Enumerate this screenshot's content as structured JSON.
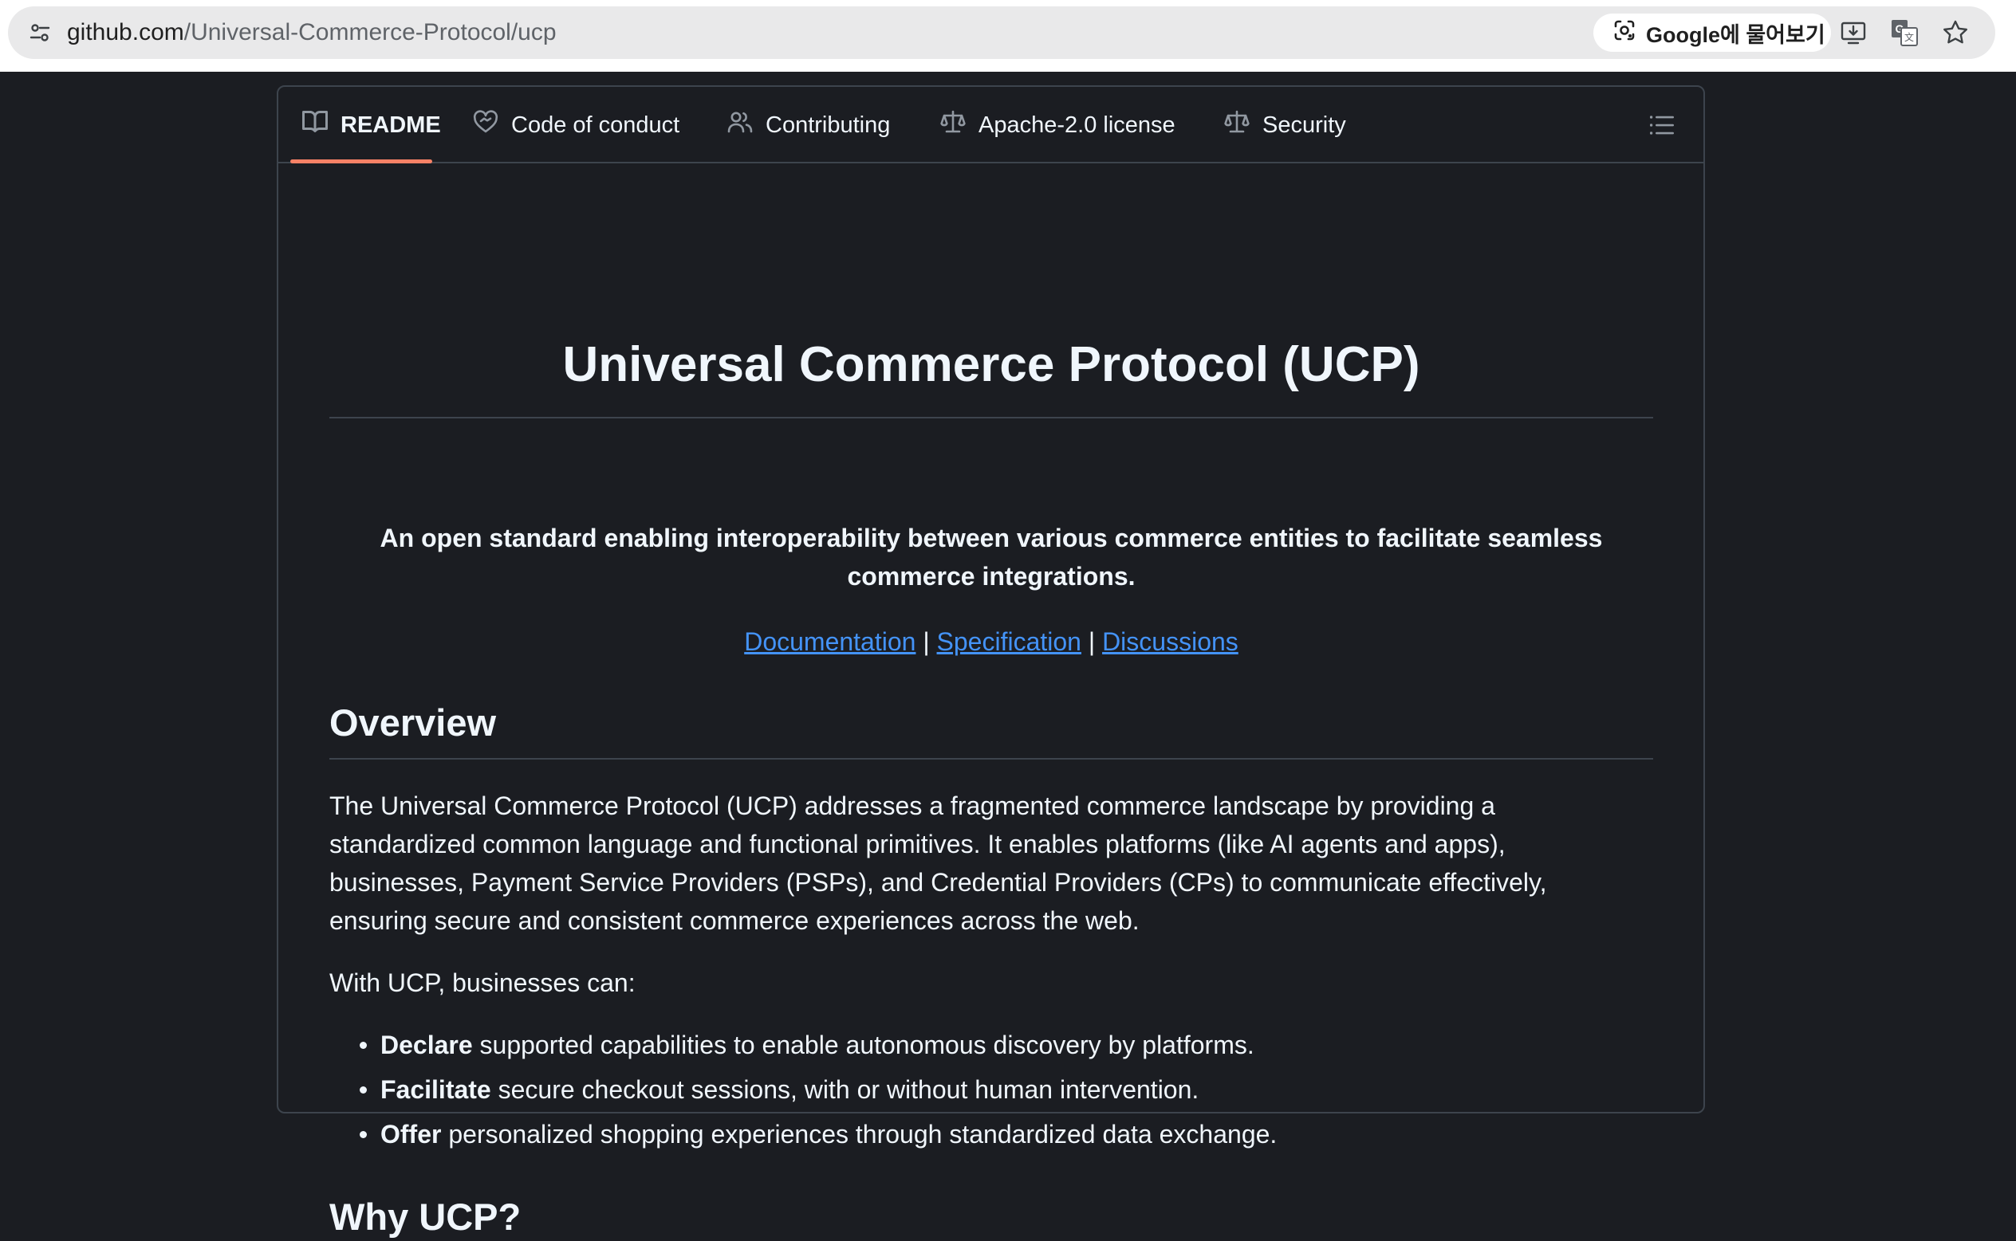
{
  "browser": {
    "url_host": "github.com",
    "url_path": "/Universal-Commerce-Protocol/ucp",
    "lens_label": "Google에 물어보기"
  },
  "tabs": [
    {
      "label": "README",
      "icon": "book-icon",
      "active": true
    },
    {
      "label": "Code of conduct",
      "icon": "code-of-conduct-icon",
      "active": false
    },
    {
      "label": "Contributing",
      "icon": "people-icon",
      "active": false
    },
    {
      "label": "Apache-2.0 license",
      "icon": "law-icon",
      "active": false
    },
    {
      "label": "Security",
      "icon": "law-icon",
      "active": false
    }
  ],
  "readme": {
    "title": "Universal Commerce Protocol (UCP)",
    "tagline": "An open standard enabling interoperability between various commerce entities to facilitate seamless commerce integrations.",
    "links": {
      "documentation": "Documentation",
      "separator": "|",
      "specification": "Specification",
      "discussions": "Discussions"
    },
    "overview_heading": "Overview",
    "overview_text": "The Universal Commerce Protocol (UCP) addresses a fragmented commerce landscape by providing a standardized common language and functional primitives. It enables platforms (like AI agents and apps), businesses, Payment Service Providers (PSPs), and Credential Providers (CPs) to communicate effectively, ensuring secure and consistent commerce experiences across the web.",
    "with_ucp_text": "With UCP, businesses can:",
    "bullets": [
      {
        "bold": "Declare",
        "rest": " supported capabilities to enable autonomous discovery by platforms."
      },
      {
        "bold": "Facilitate",
        "rest": " secure checkout sessions, with or without human intervention."
      },
      {
        "bold": "Offer",
        "rest": " personalized shopping experiences through standardized data exchange."
      }
    ],
    "why_heading": "Why UCP?"
  },
  "colors": {
    "page_bg": "#1b1d22",
    "text": "#f0f6fc",
    "link": "#4493f8",
    "border": "#3d444d",
    "active_tab_underline": "#f78166"
  }
}
